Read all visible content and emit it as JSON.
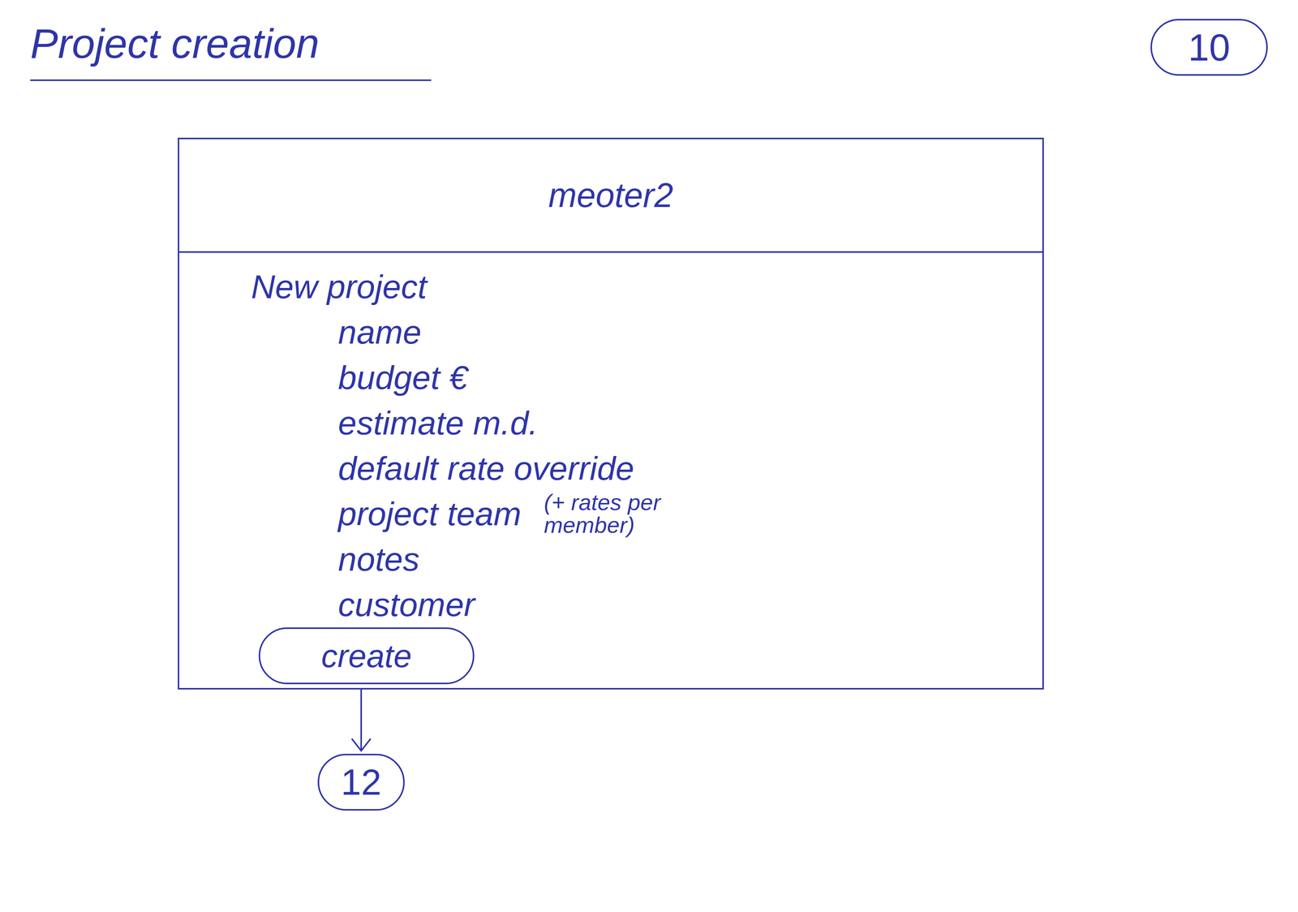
{
  "page": {
    "title": "Project creation",
    "number": "10"
  },
  "window": {
    "title": "meoter2"
  },
  "form": {
    "heading": "New project",
    "fields": [
      {
        "label": "name"
      },
      {
        "label": "budget €"
      },
      {
        "label": "estimate m.d."
      },
      {
        "label": "default rate override"
      },
      {
        "label": "project team",
        "note": "(+ rates per member)"
      },
      {
        "label": "notes"
      },
      {
        "label": "customer"
      }
    ],
    "button": "create"
  },
  "next": {
    "number": "12"
  }
}
